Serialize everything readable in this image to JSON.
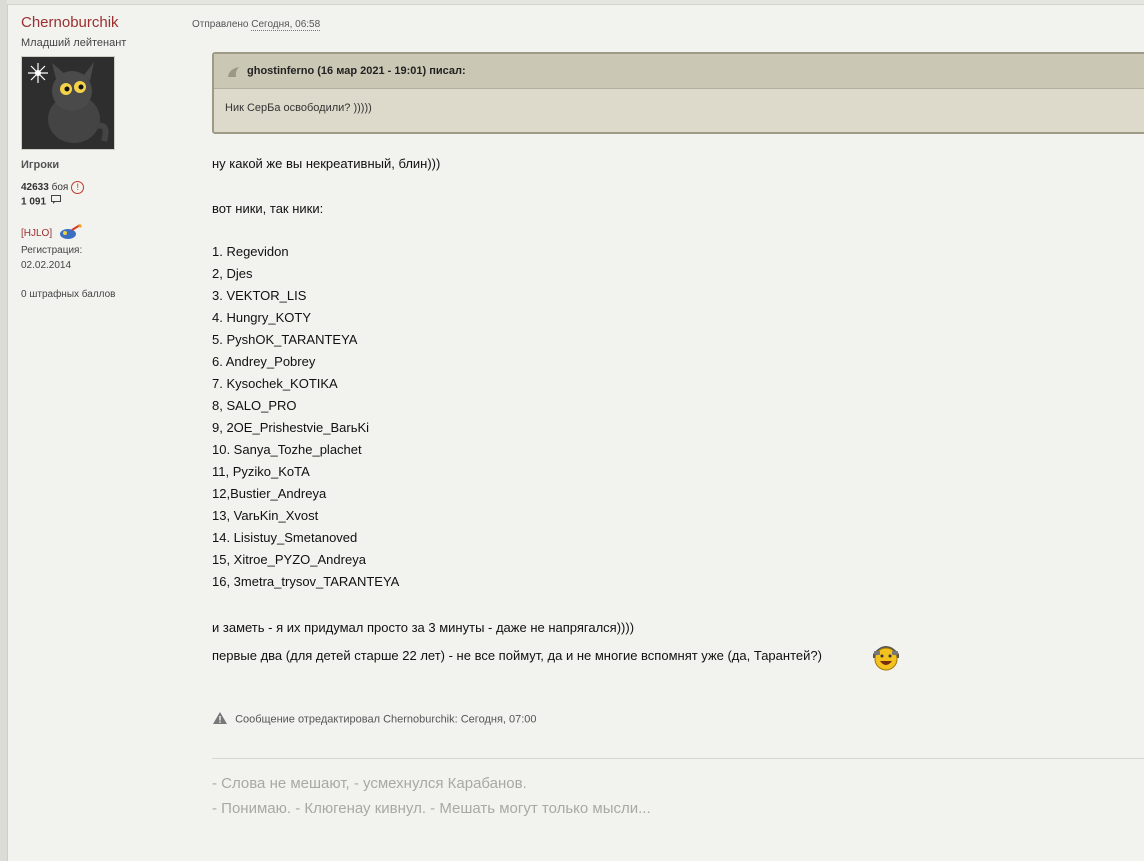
{
  "author": {
    "name": "Chernoburchik",
    "rank": "Младший лейтенант",
    "group": "Игроки",
    "battles_count": "42633",
    "battles_label": "боя",
    "posts_count": "1 091",
    "clan_tag": "[HJLO]",
    "reg_label": "Регистрация:",
    "reg_date": "02.02.2014",
    "penalty": "0 штрафных баллов"
  },
  "post": {
    "posted_prefix": "Отправлено",
    "posted_date": "Сегодня, 06:58",
    "quote": {
      "author_line": "ghostinferno (16 мар 2021 - 19:01) писал:",
      "text": "Ник СерБа освободили? )))))"
    },
    "line1": "ну какой же вы некреативный, блин)))",
    "line2": "вот ники, так ники:",
    "nicks": [
      "1. Regevidon",
      "2, Djes",
      "3. VEKTOR_LIS",
      "4. Hungry_KOTY",
      "5. PyshOK_TARANTEYA",
      "6. Andrey_Pobrey",
      "7. Kysochek_KOTIKA",
      "8, SALO_PRO",
      "9, 2OE_Prishestvie_BarьKi",
      "10. Sanya_Tozhe_plachet",
      "11, Pyziko_KoTA",
      "12,Bustier_Andreya",
      "13, VarьKin_Xvost",
      "14. Lisistuy_Smetanoved",
      "15, Xitroe_PYZO_Andreya",
      "16, 3metra_trysov_TARANTEYA"
    ],
    "line3": "и заметь - я их придумал просто за 3 минуты - даже не напрягался))))",
    "line4": "первые два (для детей старше 22 лет) - не все поймут, да и не многие вспомнят уже (да, Тарантей?)",
    "edited_note": "Сообщение отредактировал Chernoburchik: Сегодня, 07:00"
  },
  "signature": {
    "line1": "- Слова не мешают, - усмехнулся Карабанов.",
    "line2": "- Понимаю. - Клюгенау кивнул. - Мешать могут только мысли..."
  },
  "colors": {
    "author_name": "#9a2f2f",
    "quote_bg": "#dddacb",
    "quote_border": "#9e9a86",
    "signature": "#a8a8a4"
  },
  "icons": [
    "cat-avatar",
    "info-icon",
    "chat-icon",
    "clan-emblem-icon",
    "quote-icon",
    "smiley-icon",
    "warning-icon"
  ]
}
